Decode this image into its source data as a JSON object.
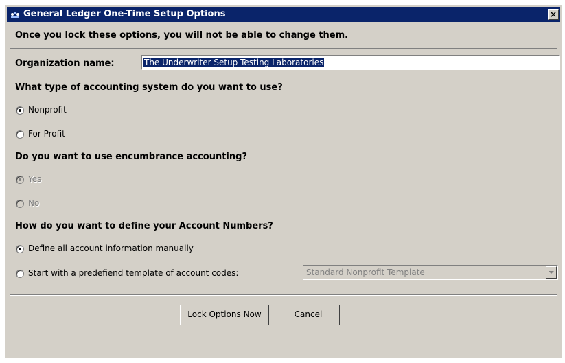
{
  "window": {
    "title": "General Ledger One-Time Setup Options",
    "close_label": "×"
  },
  "warning": "Once you lock these options, you will not be able to change them.",
  "organization": {
    "label": "Organization name:",
    "value": "The Underwriter Setup Testing Laboratories"
  },
  "accounting_system": {
    "question": "What type of accounting system do you want to use?",
    "options": [
      {
        "label": "Nonprofit",
        "selected": true,
        "enabled": true
      },
      {
        "label": "For Profit",
        "selected": false,
        "enabled": true
      }
    ]
  },
  "encumbrance": {
    "question": "Do you want to use encumbrance accounting?",
    "options": [
      {
        "label": "Yes",
        "selected": true,
        "enabled": false
      },
      {
        "label": "No",
        "selected": false,
        "enabled": false
      }
    ]
  },
  "account_numbers": {
    "question": "How do you want to define your Account Numbers?",
    "options": [
      {
        "label": "Define all account information manually",
        "selected": true,
        "enabled": true
      },
      {
        "label": "Start with a predefiend template of account codes:",
        "selected": false,
        "enabled": true
      }
    ],
    "template_select": {
      "value": "Standard Nonprofit Template",
      "enabled": false
    }
  },
  "buttons": {
    "lock": "Lock Options Now",
    "cancel": "Cancel"
  },
  "colors": {
    "title_bar": "#0a246a",
    "face": "#d4d0c8"
  }
}
